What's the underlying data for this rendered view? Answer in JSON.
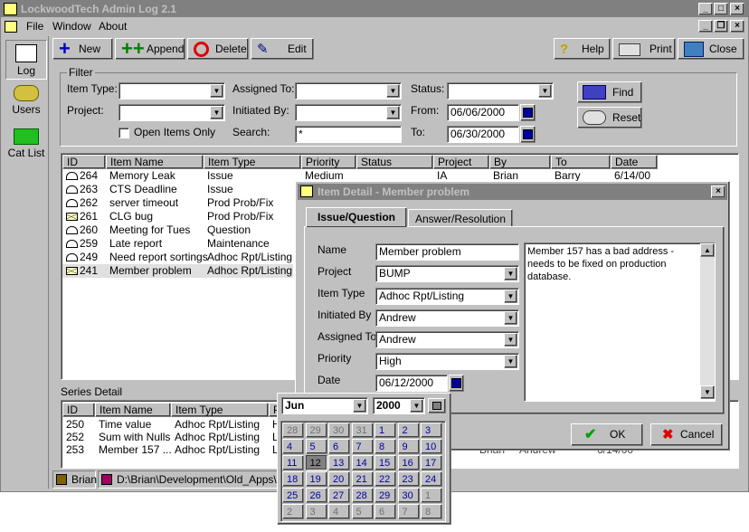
{
  "app": {
    "title": "LockwoodTech Admin Log 2.1",
    "menu": [
      "File",
      "Window",
      "About"
    ]
  },
  "toolbar": {
    "new": "New",
    "append": "Append",
    "delete": "Delete",
    "edit": "Edit",
    "help": "Help",
    "print": "Print",
    "close": "Close"
  },
  "sidebar": {
    "log": "Log",
    "users": "Users",
    "catlist": "Cat List"
  },
  "filter": {
    "legend": "Filter",
    "item_type_label": "Item Type:",
    "project_label": "Project:",
    "assigned_label": "Assigned To:",
    "initiated_label": "Initiated By:",
    "search_label": "Search:",
    "search_value": "*",
    "status_label": "Status:",
    "from_label": "From:",
    "from_value": "06/06/2000",
    "to_label": "To:",
    "to_value": "06/30/2000",
    "open_only": "Open Items Only",
    "find": "Find",
    "reset": "Reset"
  },
  "log": {
    "columns": [
      "ID",
      "Item Name",
      "Item Type",
      "Priority",
      "Status",
      "Project",
      "By",
      "To",
      "Date"
    ],
    "first_row": {
      "id": "264",
      "name": "Memory Leak",
      "type": "Issue",
      "priority": "Medium",
      "project": "IA",
      "by": "Brian",
      "to": "Barry",
      "date": "6/14/00"
    },
    "rows": [
      {
        "id": "263",
        "name": "CTS Deadline",
        "type": "Issue",
        "mail": "open"
      },
      {
        "id": "262",
        "name": "server timeout",
        "type": "Prod Prob/Fix",
        "mail": "open"
      },
      {
        "id": "261",
        "name": "CLG bug",
        "type": "Prod Prob/Fix",
        "mail": "closed"
      },
      {
        "id": "260",
        "name": "Meeting for Tues",
        "type": "Question",
        "mail": "open"
      },
      {
        "id": "259",
        "name": "Late report",
        "type": "Maintenance",
        "mail": "open"
      },
      {
        "id": "249",
        "name": "Need report sortings",
        "type": "Adhoc Rpt/Listing",
        "mail": "open"
      },
      {
        "id": "241",
        "name": "Member problem",
        "type": "Adhoc Rpt/Listing",
        "mail": "closed"
      }
    ]
  },
  "series": {
    "title": "Series Detail",
    "columns": [
      "ID",
      "Item Name",
      "Item Type",
      "P"
    ],
    "rows": [
      {
        "id": "250",
        "name": "Time value",
        "type": "Adhoc Rpt/Listing",
        "p": "H"
      },
      {
        "id": "252",
        "name": "Sum with Nulls",
        "type": "Adhoc Rpt/Listing",
        "p": "L"
      },
      {
        "id": "253",
        "name": "Member 157 ...",
        "type": "Adhoc Rpt/Listing",
        "p": "L"
      }
    ],
    "row3_by": "Brian",
    "row3_to": "Andrew",
    "row3_date": "6/14/00"
  },
  "statusbar": {
    "user": "Brian",
    "path": "D:\\Brian\\Development\\Old_Apps\\Ad"
  },
  "dialog": {
    "title": "Item Detail - Member problem",
    "tabs": [
      "Issue/Question",
      "Answer/Resolution"
    ],
    "name_label": "Name",
    "name_value": "Member problem",
    "project_label": "Project",
    "project_value": "BUMP",
    "item_type_label": "Item Type",
    "item_type_value": "Adhoc Rpt/Listing",
    "initiated_label": "Initiated By",
    "initiated_value": "Andrew",
    "assigned_label": "Assigned To",
    "assigned_value": "Andrew",
    "priority_label": "Priority",
    "priority_value": "High",
    "date_label": "Date",
    "date_value": "06/12/2000",
    "description": "Member 157 has a bad address - needs to be fixed on production database.",
    "ok": "OK",
    "cancel": "Cancel"
  },
  "calendar": {
    "month": "Jun",
    "year": "2000",
    "weeks": [
      [
        "28",
        "29",
        "30",
        "31",
        "1",
        "2",
        "3"
      ],
      [
        "4",
        "5",
        "6",
        "7",
        "8",
        "9",
        "10"
      ],
      [
        "11",
        "12",
        "13",
        "14",
        "15",
        "16",
        "17"
      ],
      [
        "18",
        "19",
        "20",
        "21",
        "22",
        "23",
        "24"
      ],
      [
        "25",
        "26",
        "27",
        "28",
        "29",
        "30",
        "1"
      ],
      [
        "2",
        "3",
        "4",
        "5",
        "6",
        "7",
        "8"
      ]
    ],
    "selected": "12"
  }
}
